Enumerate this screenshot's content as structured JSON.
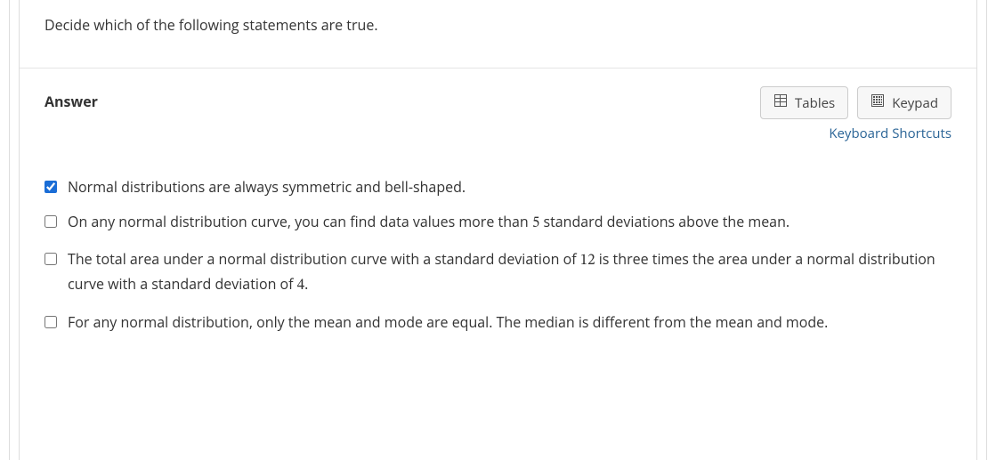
{
  "question": {
    "prompt": "Decide which of the following statements are true."
  },
  "answer": {
    "heading": "Answer",
    "buttons": {
      "tables": "Tables",
      "keypad": "Keypad"
    },
    "shortcuts_link": "Keyboard Shortcuts",
    "options": [
      {
        "checked": true,
        "text": "Normal distributions are always symmetric and bell-shaped."
      },
      {
        "checked": false,
        "pre": "On any normal distribution curve, you can find data values more than ",
        "num1": "5",
        "post": " standard deviations above the mean."
      },
      {
        "checked": false,
        "pre": "The total area under a normal distribution curve with a standard deviation of ",
        "num1": "12",
        "mid": " is three times the area under a normal distribution curve with a standard deviation of ",
        "num2": "4",
        "post": "."
      },
      {
        "checked": false,
        "text": "For any normal distribution, only the mean and mode are equal. The median is different from the mean and mode."
      }
    ]
  }
}
